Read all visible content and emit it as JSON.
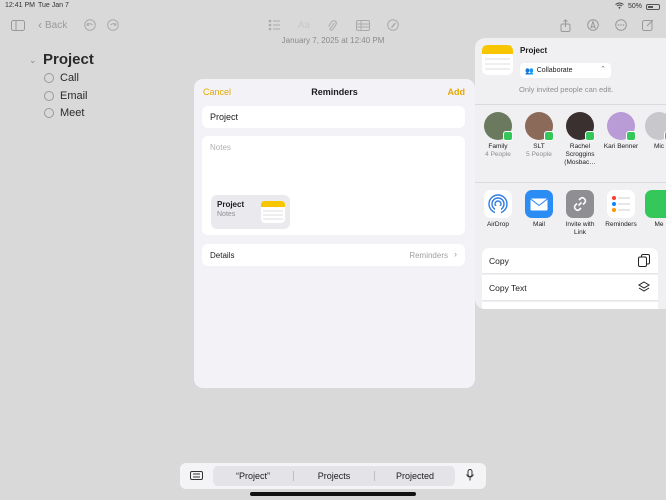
{
  "status": {
    "time": "12:41 PM",
    "date": "Tue Jan 7",
    "battery": "50%"
  },
  "toolbar": {
    "back_label": "Back"
  },
  "note": {
    "date": "January 7, 2025 at 12:40 PM",
    "title": "Project",
    "items": [
      "Call",
      "Email",
      "Meet"
    ]
  },
  "dialog": {
    "cancel": "Cancel",
    "title": "Reminders",
    "add": "Add",
    "title_value": "Project",
    "notes_placeholder": "Notes",
    "attachment": {
      "title": "Project",
      "subtitle": "Notes"
    },
    "details_label": "Details",
    "details_value": "Reminders"
  },
  "share": {
    "title": "Project",
    "collaborate": "Collaborate",
    "permission": "Only invited people can edit.",
    "people": [
      {
        "name": "Family",
        "sub": "4 People"
      },
      {
        "name": "SLT",
        "sub": "5 People"
      },
      {
        "name": "Rachel Scroggins (Mosbac…",
        "sub": ""
      },
      {
        "name": "Kari Benner",
        "sub": ""
      },
      {
        "name": "Mic",
        "sub": ""
      }
    ],
    "apps": [
      {
        "name": "AirDrop"
      },
      {
        "name": "Mail"
      },
      {
        "name": "Invite with Link"
      },
      {
        "name": "Reminders"
      },
      {
        "name": "Me"
      }
    ],
    "actions": [
      "Copy",
      "Copy Text"
    ]
  },
  "keyboard": {
    "suggestions": [
      "“Project”",
      "Projects",
      "Projected"
    ]
  }
}
